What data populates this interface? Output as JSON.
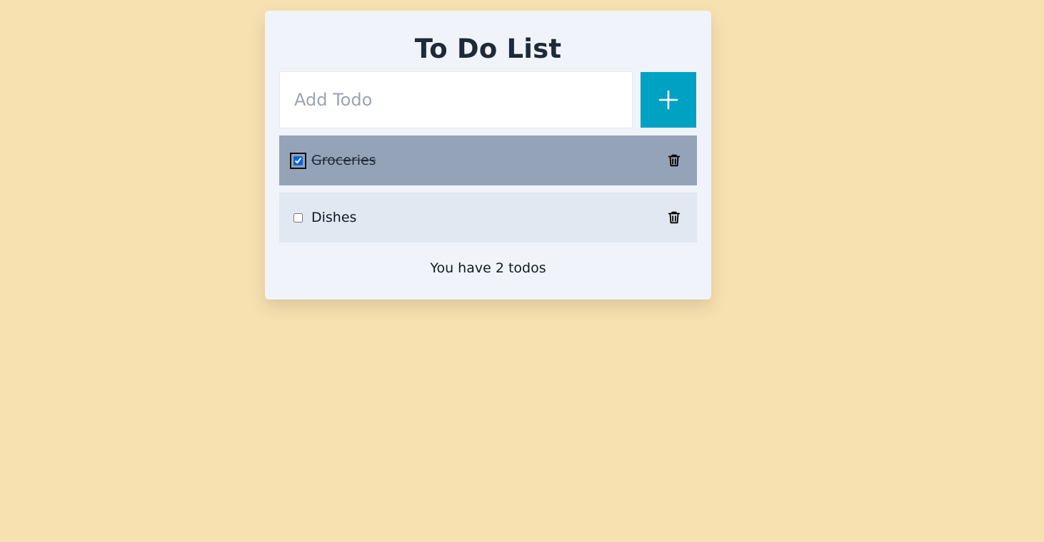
{
  "app": {
    "title": "To Do List"
  },
  "add_todo": {
    "placeholder": "Add Todo",
    "value": "",
    "button_icon": "plus-icon"
  },
  "todos": [
    {
      "label": "Groceries",
      "completed": true,
      "delete_icon": "trash-icon"
    },
    {
      "label": "Dishes",
      "completed": false,
      "delete_icon": "trash-icon"
    }
  ],
  "footer": {
    "summary": "You have 2 todos"
  },
  "colors": {
    "background": "#f8e1b0",
    "card": "#f0f4fa",
    "accent": "#00a2c4",
    "completed_row": "#94a3b8",
    "active_row": "#e1e8f1"
  }
}
